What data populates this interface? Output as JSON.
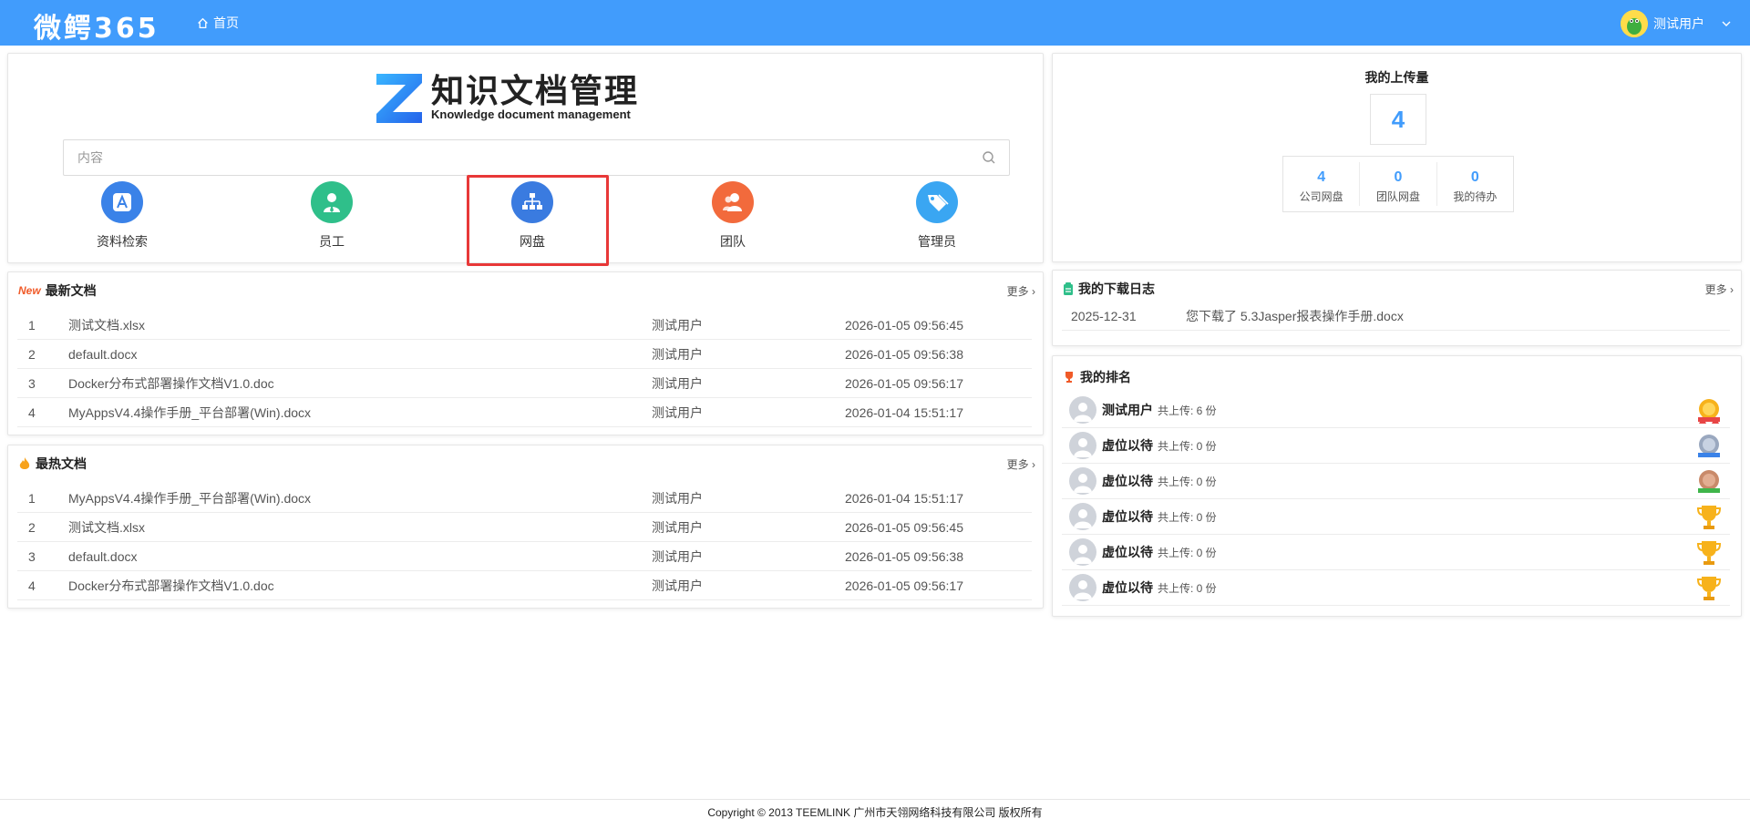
{
  "header": {
    "logo_text": "微鳄365",
    "nav_home": "首页",
    "user_name": "测试用户",
    "accent_color": "#419cfc"
  },
  "search_panel": {
    "brand_title": "知识文档管理",
    "brand_subtitle": "Knowledge document management",
    "search_placeholder": "内容",
    "quick_links": [
      {
        "label": "资料检索",
        "icon": "app-store-icon",
        "color": "#3a82e8"
      },
      {
        "label": "员工",
        "icon": "employee-icon",
        "color": "#2fbf8a"
      },
      {
        "label": "网盘",
        "icon": "network-disk-icon",
        "color": "#3a7be0"
      },
      {
        "label": "团队",
        "icon": "team-icon",
        "color": "#f26a3c"
      },
      {
        "label": "管理员",
        "icon": "admin-tag-icon",
        "color": "#3aa6f2"
      }
    ]
  },
  "latest_docs": {
    "title": "最新文档",
    "badge": "New",
    "more": "更多",
    "rows": [
      {
        "no": "1",
        "name": "测试文档.xlsx",
        "user": "测试用户",
        "time": "2026-01-05 09:56:45"
      },
      {
        "no": "2",
        "name": "default.docx",
        "user": "测试用户",
        "time": "2026-01-05 09:56:38"
      },
      {
        "no": "3",
        "name": "Docker分布式部署操作文档V1.0.doc",
        "user": "测试用户",
        "time": "2026-01-05 09:56:17"
      },
      {
        "no": "4",
        "name": "MyAppsV4.4操作手册_平台部署(Win).docx",
        "user": "测试用户",
        "time": "2026-01-04 15:51:17"
      }
    ]
  },
  "hot_docs": {
    "title": "最热文档",
    "more": "更多",
    "rows": [
      {
        "no": "1",
        "name": "MyAppsV4.4操作手册_平台部署(Win).docx",
        "user": "测试用户",
        "time": "2026-01-04 15:51:17"
      },
      {
        "no": "2",
        "name": "测试文档.xlsx",
        "user": "测试用户",
        "time": "2026-01-05 09:56:45"
      },
      {
        "no": "3",
        "name": "default.docx",
        "user": "测试用户",
        "time": "2026-01-05 09:56:38"
      },
      {
        "no": "4",
        "name": "Docker分布式部署操作文档V1.0.doc",
        "user": "测试用户",
        "time": "2026-01-05 09:56:17"
      }
    ]
  },
  "upload": {
    "title": "我的上传量",
    "total": "4",
    "stats": [
      {
        "value": "4",
        "label": "公司网盘"
      },
      {
        "value": "0",
        "label": "团队网盘"
      },
      {
        "value": "0",
        "label": "我的待办"
      }
    ]
  },
  "download_log": {
    "title": "我的下载日志",
    "more": "更多",
    "rows": [
      {
        "date": "2025-12-31",
        "text": "您下载了 5.3Jasper报表操作手册.docx"
      }
    ]
  },
  "ranking": {
    "title": "我的排名",
    "rows": [
      {
        "name": "测试用户",
        "count": "共上传: 6 份",
        "medal": "gold-medal-icon"
      },
      {
        "name": "虚位以待",
        "count": "共上传: 0 份",
        "medal": "silver-medal-icon"
      },
      {
        "name": "虚位以待",
        "count": "共上传: 0 份",
        "medal": "bronze-medal-icon"
      },
      {
        "name": "虚位以待",
        "count": "共上传: 0 份",
        "medal": "trophy-icon"
      },
      {
        "name": "虚位以待",
        "count": "共上传: 0 份",
        "medal": "trophy-icon"
      },
      {
        "name": "虚位以待",
        "count": "共上传: 0 份",
        "medal": "trophy-icon"
      }
    ]
  },
  "footer": {
    "text": "Copyright © 2013 TEEMLINK 广州市天翎网络科技有限公司 版权所有"
  }
}
